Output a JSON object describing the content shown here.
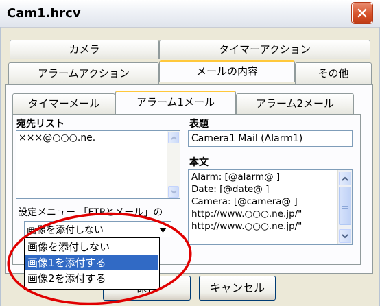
{
  "window": {
    "title": "Cam1.hrcv"
  },
  "outer_tabs": {
    "camera": "カメラ",
    "timer_action": "タイマーアクション",
    "alarm_action": "アラームアクション",
    "mail_content": "メールの内容",
    "other": "その他"
  },
  "inner_tabs": {
    "timer_mail": "タイマーメール",
    "alarm1_mail": "アラーム1メール",
    "alarm2_mail": "アラーム2メール"
  },
  "recipients": {
    "label": "宛先リスト",
    "items": [
      "×××@○○○.ne."
    ]
  },
  "subject": {
    "label": "表題",
    "value": "Camera1 Mail (Alarm1)"
  },
  "body": {
    "label": "本文",
    "lines": [
      "Alarm:  [@alarm@ ]",
      "Date:   [@date@ ]",
      "Camera: [@camera@ ]",
      "http://www.○○○.ne.jp/\"",
      "http://www.○○○.ne.jp/\""
    ]
  },
  "settings": {
    "label": "設定メニュー 「FTPとメール」の",
    "selected": "画像を添付しない",
    "options": [
      "画像を添付しない",
      "画像1を添付する",
      "画像2を添付する"
    ],
    "highlighted_index": 1
  },
  "buttons": {
    "save": "保存",
    "cancel": "キャンセル"
  },
  "colors": {
    "selection": "#316ac5",
    "annotation": "#e00000",
    "close": "#d6532b"
  }
}
